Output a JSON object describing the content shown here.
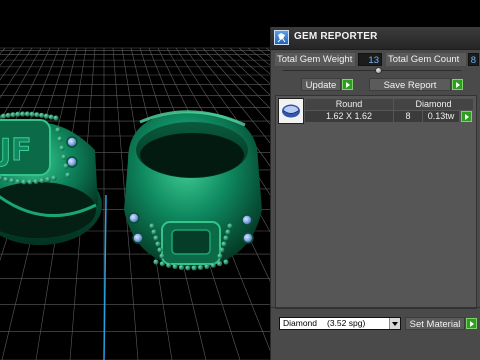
{
  "panel": {
    "title": "GEM REPORTER",
    "total_gem_weight_label": "Total Gem Weight",
    "total_gem_weight_value": "13",
    "total_gem_count_label": "Total Gem Count",
    "total_gem_count_value": "8",
    "update_label": "Update",
    "save_report_label": "Save Report",
    "gems": [
      {
        "cut": "Round",
        "material": "Diamond",
        "size": "1.62 X 1.62",
        "count": "8",
        "weight": "0.13tw"
      }
    ],
    "material_select": {
      "name": "Diamond",
      "spg": "(3.52 spg)"
    },
    "set_material_label": "Set Material"
  },
  "colors": {
    "viewport_bg": "#000000",
    "grid": "#5c5c5c",
    "ring_green": "#0e7a55",
    "gem_blue": "#8fb3e8",
    "panel_bg": "#4a4a4a",
    "accent_green_button": "#2f9d22",
    "value_text": "#6fb6ff"
  },
  "icons": [
    "gem-reporter-app-icon",
    "round-gem-icon",
    "play-arrow-icon",
    "dropdown-arrow-icon"
  ]
}
